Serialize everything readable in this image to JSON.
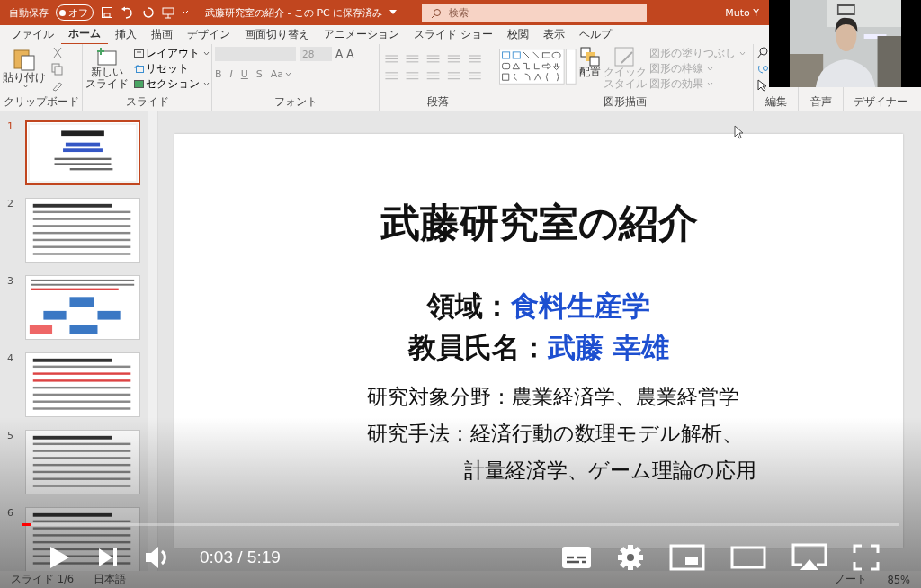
{
  "title_bar": {
    "autosave_label": "自動保存",
    "autosave_toggle": {
      "text": "オフ",
      "on": false
    },
    "document_title": "武藤研究室の紹介 - この PC に保存済み",
    "search": {
      "placeholder": "検索"
    },
    "user": "Muto Y"
  },
  "ribbon_tabs": [
    {
      "label": "ファイル",
      "selected": false
    },
    {
      "label": "ホーム",
      "selected": true
    },
    {
      "label": "挿入",
      "selected": false
    },
    {
      "label": "描画",
      "selected": false
    },
    {
      "label": "デザイン",
      "selected": false
    },
    {
      "label": "画面切り替え",
      "selected": false
    },
    {
      "label": "アニメーション",
      "selected": false
    },
    {
      "label": "スライド ショー",
      "selected": false
    },
    {
      "label": "校閲",
      "selected": false
    },
    {
      "label": "表示",
      "selected": false
    },
    {
      "label": "ヘルプ",
      "selected": false
    }
  ],
  "ribbon": {
    "clipboard": {
      "paste": "貼り付け",
      "label": "クリップボード"
    },
    "slides": {
      "new_slide": [
        "新しい",
        "スライド"
      ],
      "layout": "レイアウト",
      "reset": "リセット",
      "section": "セクション",
      "label": "スライド"
    },
    "font": {
      "size": "28",
      "grow": "A",
      "shrink": "A",
      "bold": "B",
      "italic": "I",
      "underline": "U",
      "shadow": "S",
      "case": "Aa",
      "label": "フォント"
    },
    "paragraph": {
      "label": "段落"
    },
    "drawing": {
      "arrange": "配置",
      "quick_style": [
        "クイック",
        "スタイル"
      ],
      "fill": "図形の塗りつぶし",
      "outline": "図形の枠線",
      "effects": "図形の効果",
      "label": "図形描画"
    },
    "editing": {
      "label": "編集"
    },
    "voice": {
      "label": "音声"
    },
    "designer": {
      "label": "デザイナー"
    }
  },
  "thumbnails": [
    {
      "number": "1",
      "selected": true,
      "kind": "title"
    },
    {
      "number": "2",
      "selected": false,
      "kind": "text"
    },
    {
      "number": "3",
      "selected": false,
      "kind": "diagram"
    },
    {
      "number": "4",
      "selected": false,
      "kind": "text"
    },
    {
      "number": "5",
      "selected": false,
      "kind": "text"
    },
    {
      "number": "6",
      "selected": false,
      "kind": "text"
    }
  ],
  "slide": {
    "title": "武藤研究室の紹介",
    "fields": [
      {
        "label": "領域：",
        "value": "食料生産学"
      },
      {
        "label": "教員氏名：",
        "value": "武藤 幸雄"
      }
    ],
    "lines": [
      {
        "text": "研究対象分野：農業経済学、農業経営学",
        "indent": false
      },
      {
        "text": "研究手法：経済行動の数理モデル解析、",
        "indent": false
      },
      {
        "text": "計量経済学、ゲーム理論の応用",
        "indent": true
      }
    ]
  },
  "player": {
    "progress": {
      "level": 0.01
    },
    "time": "0:03 / 5:19"
  },
  "status_bar": {
    "slide": "スライド 1/6",
    "language": "日本語",
    "notes": "ノート",
    "zoom": "85%"
  }
}
